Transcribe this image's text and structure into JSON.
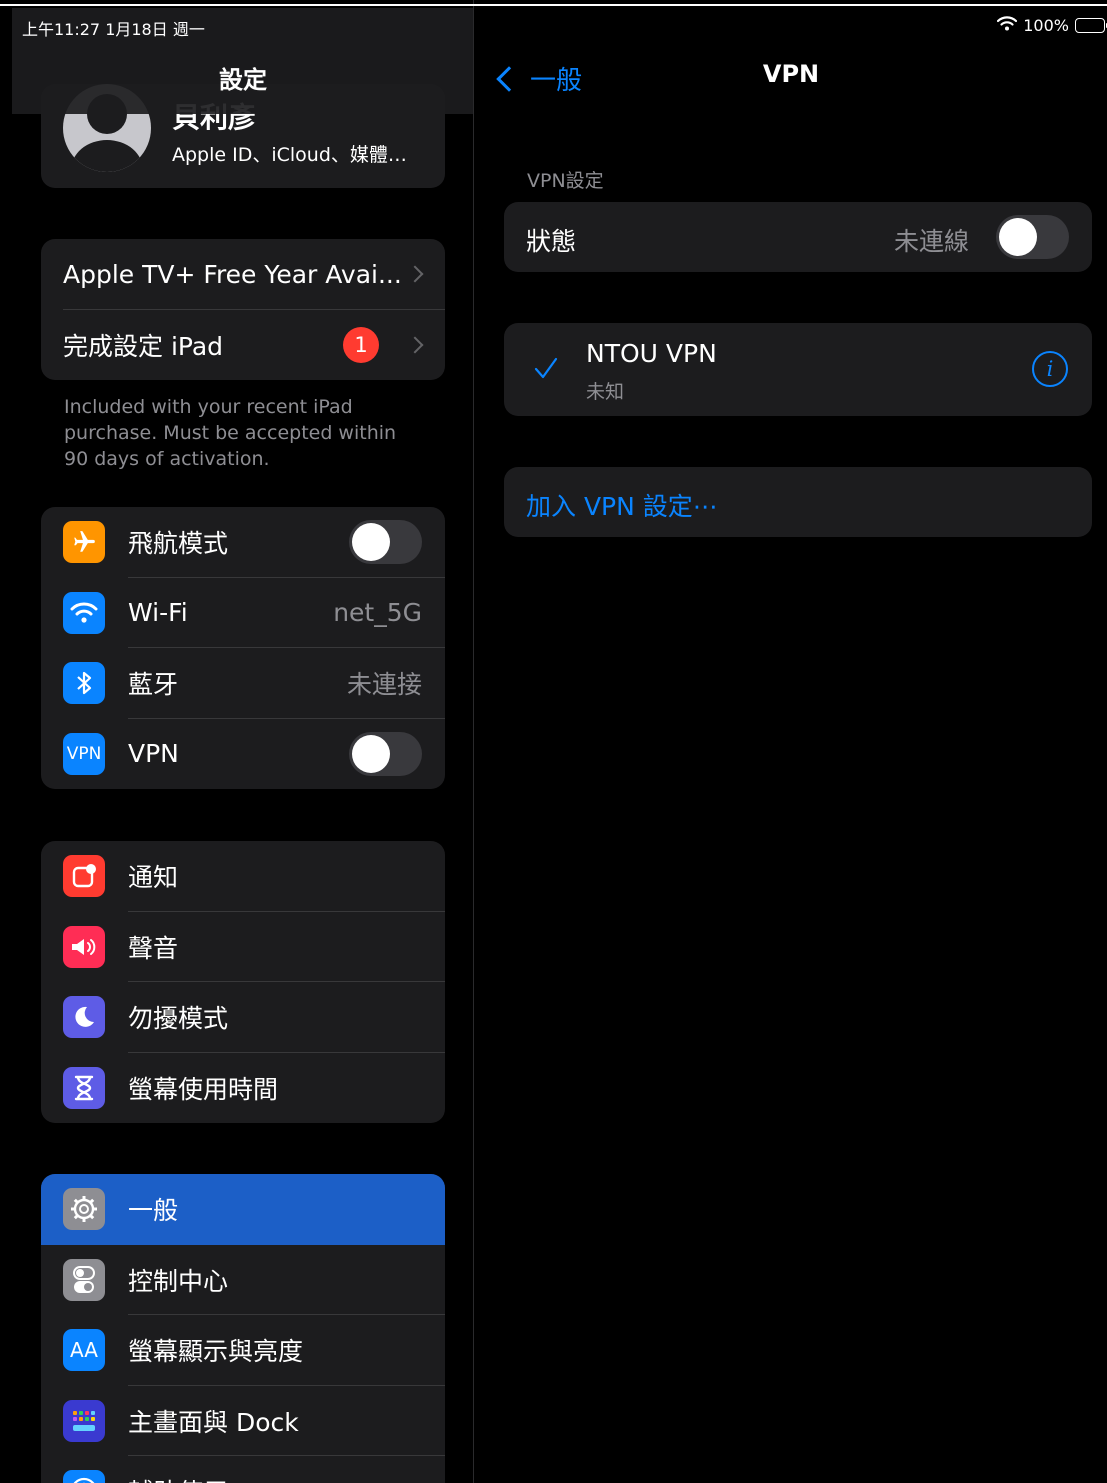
{
  "status_bar": {
    "time": "上午11:27  1月18日 週一",
    "battery": "100%"
  },
  "sidebar": {
    "title": "設定",
    "profile": {
      "name": "貝利彥",
      "subtitle": "Apple ID、iCloud、媒體…"
    },
    "promo": {
      "items": [
        {
          "label": "Apple TV+ Free Year Avai..."
        },
        {
          "label": "完成設定 iPad",
          "badge": "1"
        }
      ],
      "footnote": "Included with your recent iPad purchase. Must be accepted within 90 days of activation."
    },
    "connectivity": [
      {
        "label": "飛航模式",
        "icon": "airplane-icon",
        "color": "#ff9500",
        "toggle": false
      },
      {
        "label": "Wi-Fi",
        "icon": "wifi-icon",
        "color": "#0a84ff",
        "value": "net_5G"
      },
      {
        "label": "藍牙",
        "icon": "bluetooth-icon",
        "color": "#0a84ff",
        "value": "未連接"
      },
      {
        "label": "VPN",
        "icon": "vpn-icon",
        "icon_text": "VPN",
        "color": "#0a84ff",
        "toggle": false
      }
    ],
    "notifications": [
      {
        "label": "通知",
        "icon": "notification-icon",
        "color": "#ff3b30"
      },
      {
        "label": "聲音",
        "icon": "speaker-icon",
        "color": "#ff2d55"
      },
      {
        "label": "勿擾模式",
        "icon": "moon-icon",
        "color": "#5e5ce6"
      },
      {
        "label": "螢幕使用時間",
        "icon": "hourglass-icon",
        "color": "#5e5ce6"
      }
    ],
    "general": [
      {
        "label": "一般",
        "icon": "gear-icon",
        "color": "#8e8e93",
        "selected": true
      },
      {
        "label": "控制中心",
        "icon": "switches-icon",
        "color": "#8e8e93"
      },
      {
        "label": "螢幕顯示與亮度",
        "icon": "text-size-icon",
        "icon_text": "AA",
        "color": "#0a84ff"
      },
      {
        "label": "主畫面與 Dock",
        "icon": "home-grid-icon",
        "color": "#3a3ad0"
      },
      {
        "label": "輔助使用",
        "icon": "accessibility-icon",
        "color": "#0a84ff"
      }
    ]
  },
  "detail": {
    "back_label": "一般",
    "title": "VPN",
    "section_label": "VPN設定",
    "status": {
      "label": "狀態",
      "value": "未連線",
      "toggle": false
    },
    "vpn_entry": {
      "name": "NTOU VPN",
      "status": "未知",
      "checked": true
    },
    "add_vpn": "加入 VPN 設定⋯"
  },
  "colors": {
    "accent": "#0a84ff",
    "selected_row": "#1c5fc7",
    "badge": "#ff3b30",
    "group_bg": "#1c1c1e"
  }
}
